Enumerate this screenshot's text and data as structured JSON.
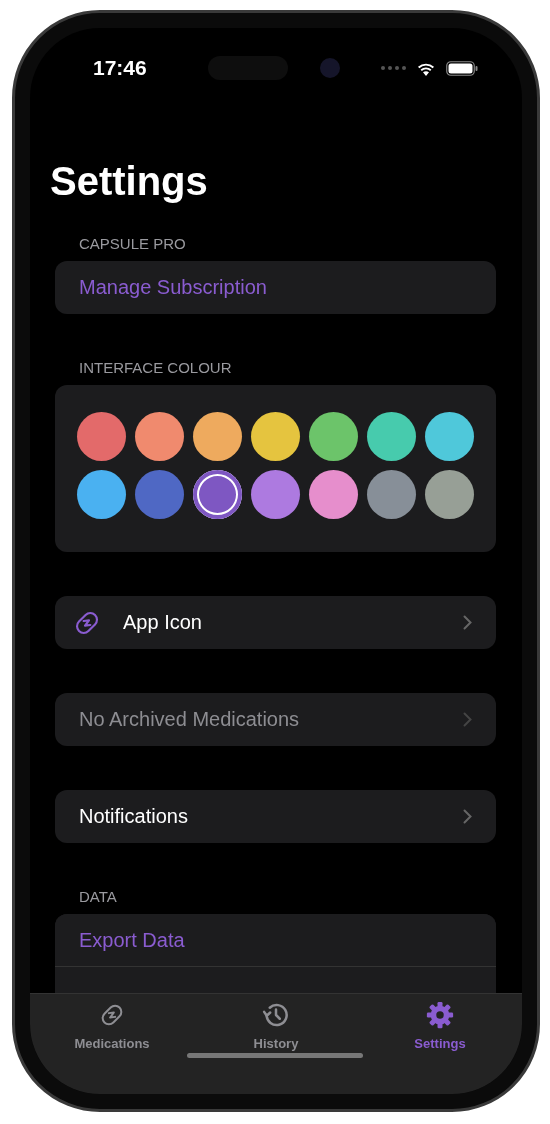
{
  "status_bar": {
    "time": "17:46"
  },
  "title": "Settings",
  "sections": [
    {
      "header": "CAPSULE PRO",
      "kind": "list",
      "rows": [
        {
          "kind": "link",
          "label": "Manage Subscription"
        }
      ]
    },
    {
      "header": "INTERFACE COLOUR",
      "kind": "colors",
      "swatches": [
        {
          "color": "#e36a6a",
          "selected": false
        },
        {
          "color": "#f08a6e",
          "selected": false
        },
        {
          "color": "#eeaa5e",
          "selected": false
        },
        {
          "color": "#e5c43f",
          "selected": false
        },
        {
          "color": "#6cc46a",
          "selected": false
        },
        {
          "color": "#47cbad",
          "selected": false
        },
        {
          "color": "#4fc8da",
          "selected": false
        },
        {
          "color": "#4ab1f1",
          "selected": false
        },
        {
          "color": "#4f68c4",
          "selected": false
        },
        {
          "color": "#7e57c2",
          "selected": true
        },
        {
          "color": "#ad7ae0",
          "selected": false
        },
        {
          "color": "#e68ecc",
          "selected": false
        },
        {
          "color": "#878f98",
          "selected": false
        },
        {
          "color": "#979f96",
          "selected": false
        }
      ]
    },
    {
      "kind": "list",
      "rows": [
        {
          "kind": "icon",
          "label": "App Icon",
          "disabled": false
        }
      ]
    },
    {
      "kind": "list",
      "rows": [
        {
          "kind": "nav",
          "label": "No Archived Medications",
          "disabled": true
        }
      ]
    },
    {
      "kind": "list",
      "rows": [
        {
          "kind": "nav",
          "label": "Notifications",
          "disabled": false
        }
      ]
    },
    {
      "header": "DATA",
      "kind": "list",
      "rows": [
        {
          "kind": "link",
          "label": "Export Data"
        }
      ]
    }
  ],
  "tabs": [
    {
      "label": "Medications",
      "selected": false
    },
    {
      "label": "History",
      "selected": false
    },
    {
      "label": "Settings",
      "selected": true
    }
  ]
}
